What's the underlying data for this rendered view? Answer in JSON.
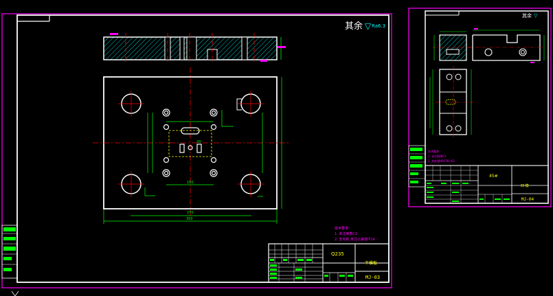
{
  "drawing1": {
    "roughness_note": "其余",
    "roughness_value": "Ra6.3",
    "material": "Q235",
    "part_name": "下模板",
    "drawing_no": "MJ-03",
    "tech_req_title": "技术要求:",
    "tech_req_1": "1. 未注倒角C1",
    "tech_req_2": "2. 去毛刺,未注公差按IT14",
    "dim_overall_width": "350",
    "dim_inner_width": "270",
    "dim_pattern_width": "150",
    "dim_center": "20"
  },
  "drawing2": {
    "roughness_note": "其余",
    "material": "45#",
    "part_name": "凹 模",
    "drawing_no": "MJ-04",
    "tech_req_title": "技术要求:",
    "tech_req_1": "1. 未注倒角C1",
    "tech_req_2": "2. 热处理HRC58~62"
  },
  "colors": {
    "background": "#000000",
    "outline": "#ffffff",
    "border": "#ff00ff",
    "centerline": "#ff0000",
    "dimension": "#00ff00",
    "hatch": "#00ffff",
    "text": "#ffff00",
    "hidden": "#ffff00"
  }
}
